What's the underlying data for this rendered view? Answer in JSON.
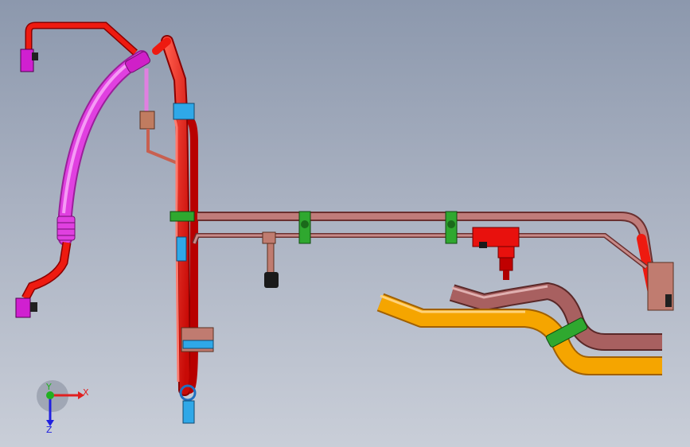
{
  "viewport": {
    "background_top": "#8c98ad",
    "background_bottom": "#c9ced8"
  },
  "axis_triad": {
    "x_label": "X",
    "y_label": "Y",
    "z_label": "Z",
    "x_color": "#e02020",
    "y_color": "#20b020",
    "z_color": "#2020e0"
  },
  "parts": {
    "red_pipe_color": "#e8110d",
    "magenta_hose_color": "#e040e0",
    "brown_pipe_color": "#b06a68",
    "orange_pipe_color": "#f5a500",
    "clamp_green_color": "#2fa82f",
    "fitting_blue_color": "#2fa8e8",
    "sensor_black_color": "#1a1a1a"
  }
}
